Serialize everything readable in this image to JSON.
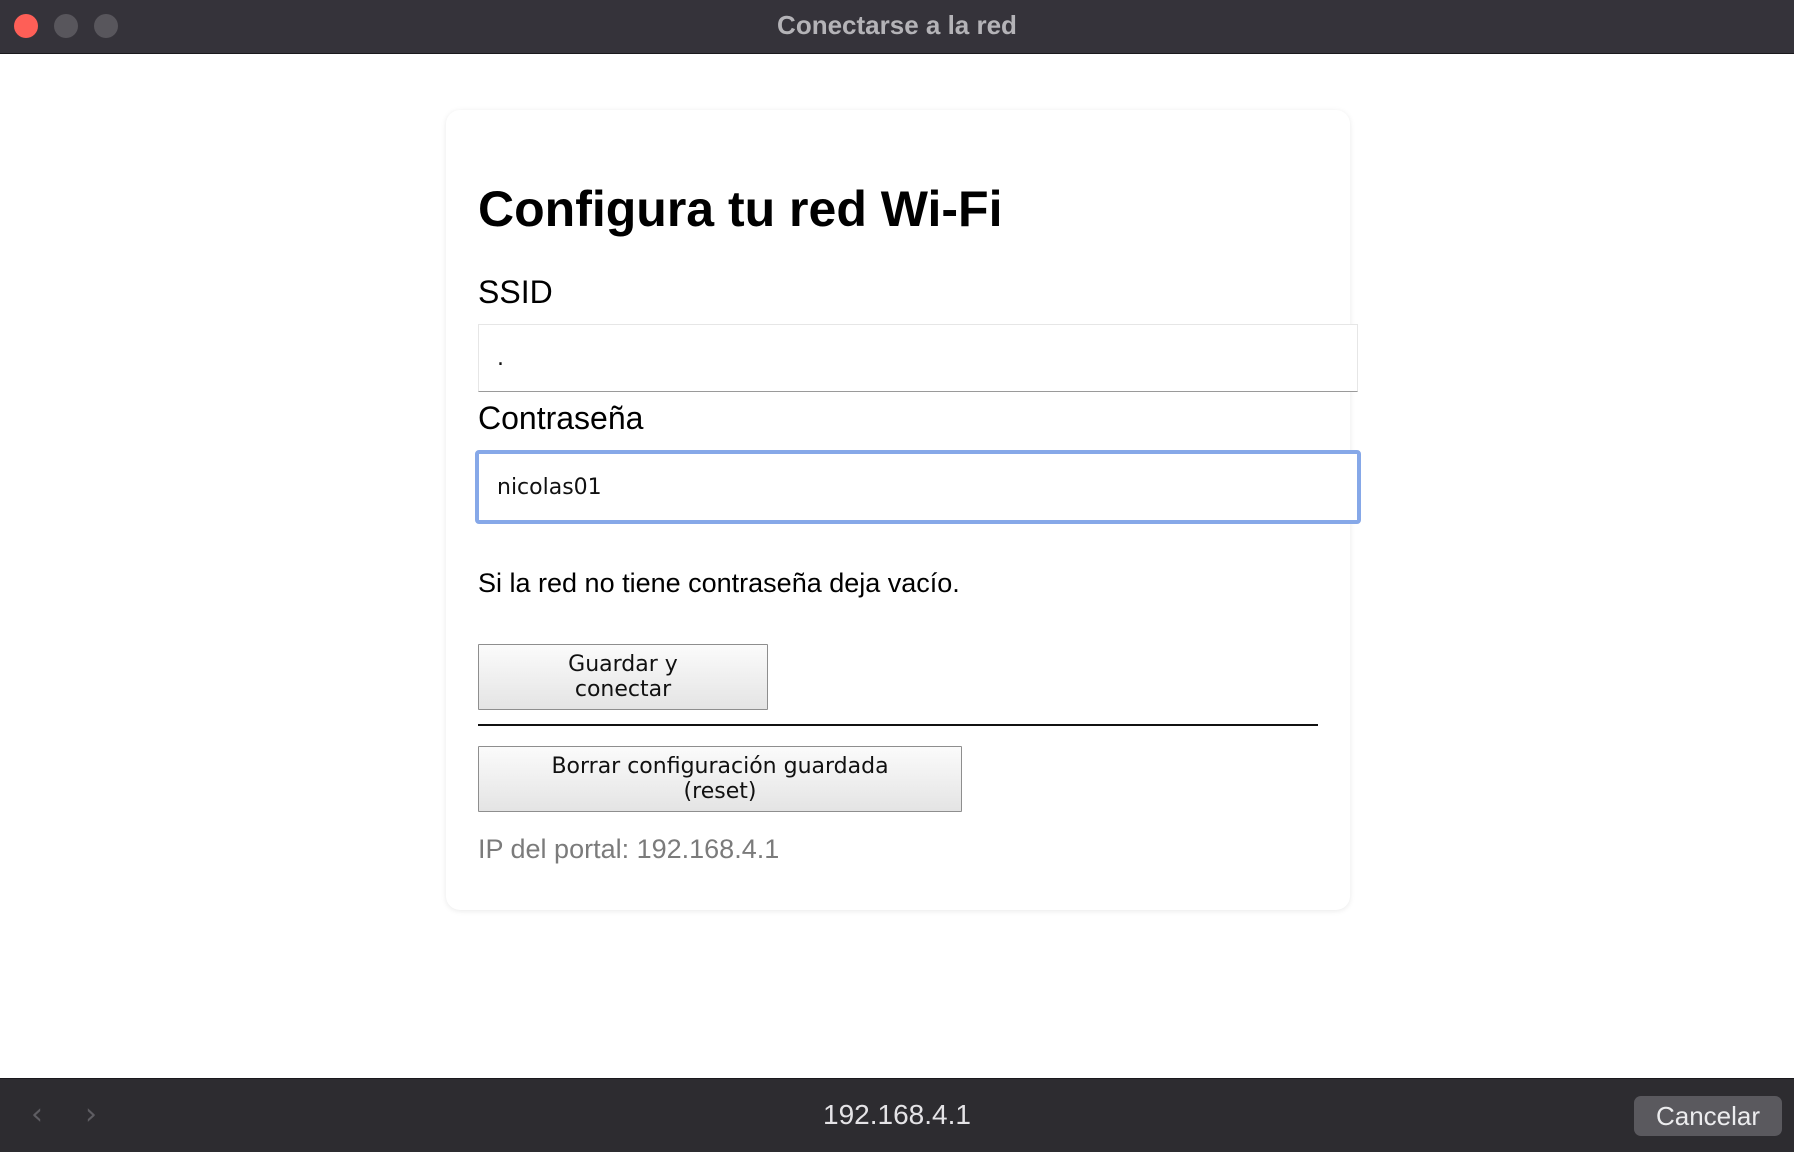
{
  "window": {
    "title": "Conectarse a la red"
  },
  "form": {
    "heading": "Configura tu red Wi-Fi",
    "ssid_label": "SSID",
    "ssid_value": ".",
    "password_label": "Contraseña",
    "password_value": "nicolas01",
    "hint": "Si la red no tiene contraseña deja vacío.",
    "save_button": "Guardar y conectar",
    "reset_button": "Borrar configuración guardada (reset)",
    "ip_text": "IP del portal: 192.168.4.1"
  },
  "bottom_bar": {
    "back_icon": "chevron-left-icon",
    "forward_icon": "chevron-right-icon",
    "url": "192.168.4.1",
    "cancel_button": "Cancelar"
  },
  "colors": {
    "close": "#fe5f57",
    "focus_ring": "#86a8e8",
    "titlebar": "#35333a"
  }
}
